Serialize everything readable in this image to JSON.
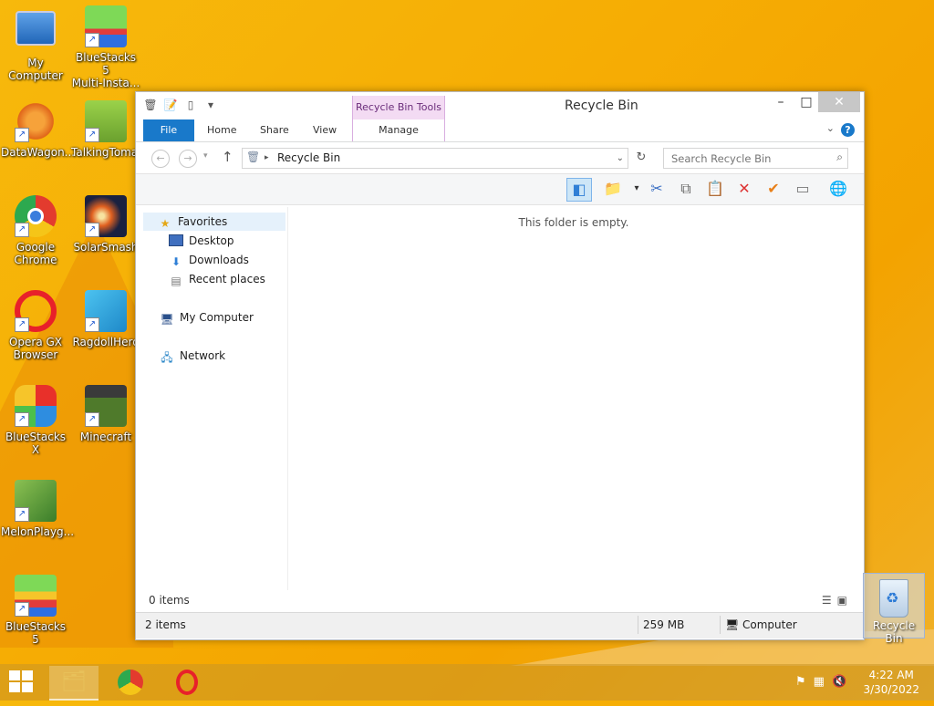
{
  "desktop": {
    "icons": [
      {
        "label": "My Computer",
        "icon": "my-computer-icon"
      },
      {
        "label": "BlueStacks 5\nMulti-Insta...",
        "icon": "bluestacks-multi-instance-icon"
      },
      {
        "label": "DataWagon...",
        "icon": "datawagon-icon"
      },
      {
        "label": "TalkingToma...",
        "icon": "talking-tom-icon"
      },
      {
        "label": "Google\nChrome",
        "icon": "chrome-icon"
      },
      {
        "label": "SolarSmash",
        "icon": "solar-smash-icon"
      },
      {
        "label": "Opera GX\nBrowser",
        "icon": "opera-gx-icon"
      },
      {
        "label": "RagdollHero",
        "icon": "ragdoll-hero-icon"
      },
      {
        "label": "BlueStacks X",
        "icon": "bluestacks-x-icon"
      },
      {
        "label": "Minecraft",
        "icon": "minecraft-icon"
      },
      {
        "label": "MelonPlayg...",
        "icon": "melon-playground-icon"
      },
      {
        "label": "BlueStacks 5",
        "icon": "bluestacks-5-icon"
      }
    ],
    "recycle_bin_label": "Recycle Bin"
  },
  "window": {
    "title": "Recycle Bin",
    "context_tab": "Recycle Bin Tools",
    "ribbon_tabs": [
      "File",
      "Home",
      "Share",
      "View",
      "Manage"
    ],
    "help": "?",
    "address": "Recycle Bin",
    "search_placeholder": "Search Recycle Bin",
    "nav": {
      "favorites": "Favorites",
      "desktop": "Desktop",
      "downloads": "Downloads",
      "recent": "Recent places",
      "computer": "My Computer",
      "network": "Network"
    },
    "empty_message": "This folder is empty.",
    "item_count": "0 items",
    "status": {
      "items": "2 items",
      "size": "259 MB",
      "location": "Computer"
    }
  },
  "taskbar": {
    "time": "4:22 AM",
    "date": "3/30/2022"
  }
}
